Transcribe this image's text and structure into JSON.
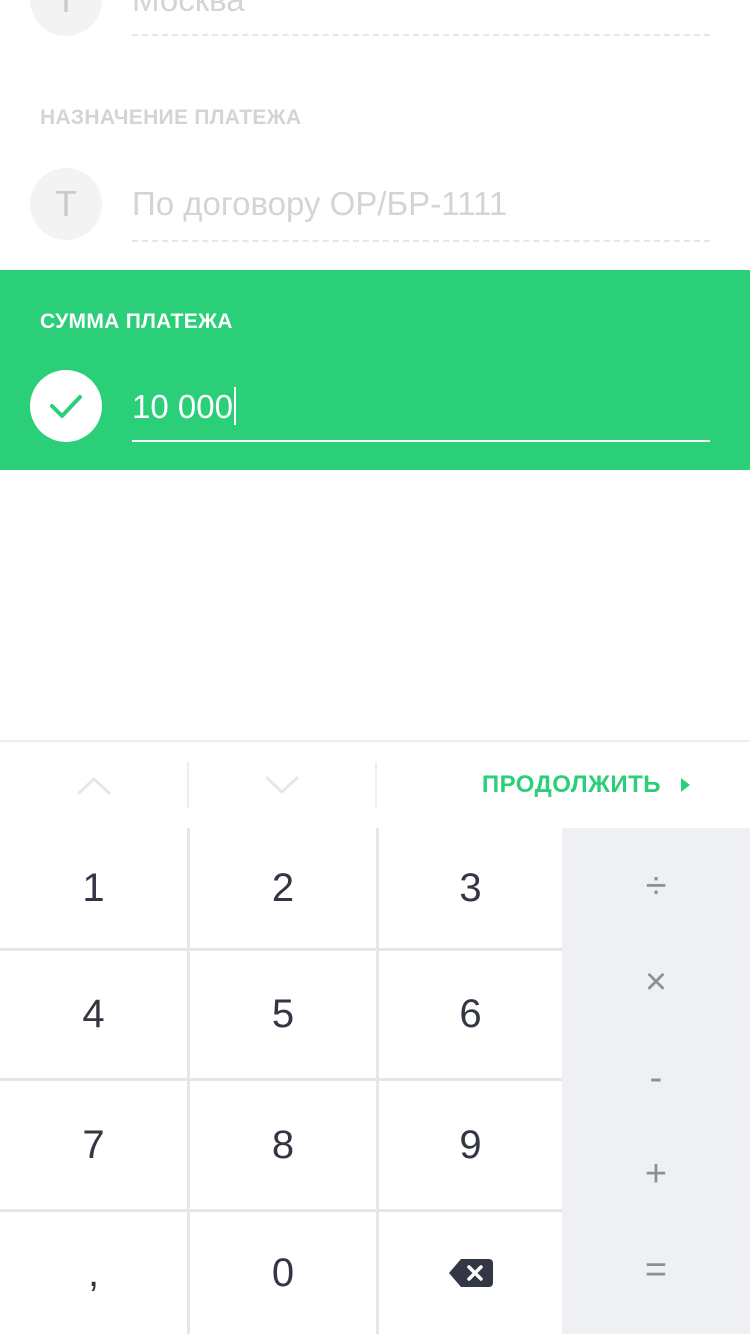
{
  "top_field": {
    "avatar_letter": "Т",
    "value": "Москва"
  },
  "purpose": {
    "label": "НАЗНАЧЕНИЕ ПЛАТЕЖА",
    "avatar_letter": "Т",
    "value": "По договору ОР/БР-1111"
  },
  "sum": {
    "label": "СУММА ПЛАТЕЖА",
    "value": "10 000"
  },
  "toolbar": {
    "continue_label": "ПРОДОЛЖИТЬ"
  },
  "keypad": {
    "digits": [
      "1",
      "2",
      "3",
      "4",
      "5",
      "6",
      "7",
      "8",
      "9",
      ",",
      "0"
    ],
    "operators": [
      "÷",
      "×",
      "-",
      "+",
      "="
    ]
  },
  "colors": {
    "accent": "#2bcf77",
    "keypad_text": "#333743",
    "operator_text": "#8a8f9a"
  }
}
